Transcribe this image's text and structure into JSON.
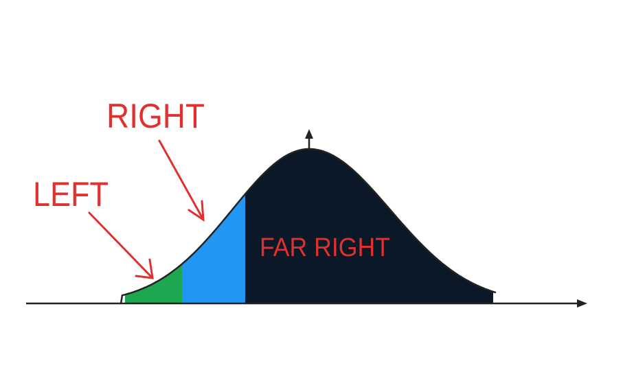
{
  "labels": {
    "left": "LEFT",
    "right": "RIGHT",
    "far_right": "FAR RIGHT"
  },
  "colors": {
    "left_region": "#1fa650",
    "right_region": "#2196f3",
    "far_right_region": "#0b1828",
    "label_text": "#e0312f",
    "axis": "#222222"
  },
  "icons": {
    "x_axis_arrow": "arrow-right-icon",
    "peak_arrow": "arrow-up-icon"
  }
}
